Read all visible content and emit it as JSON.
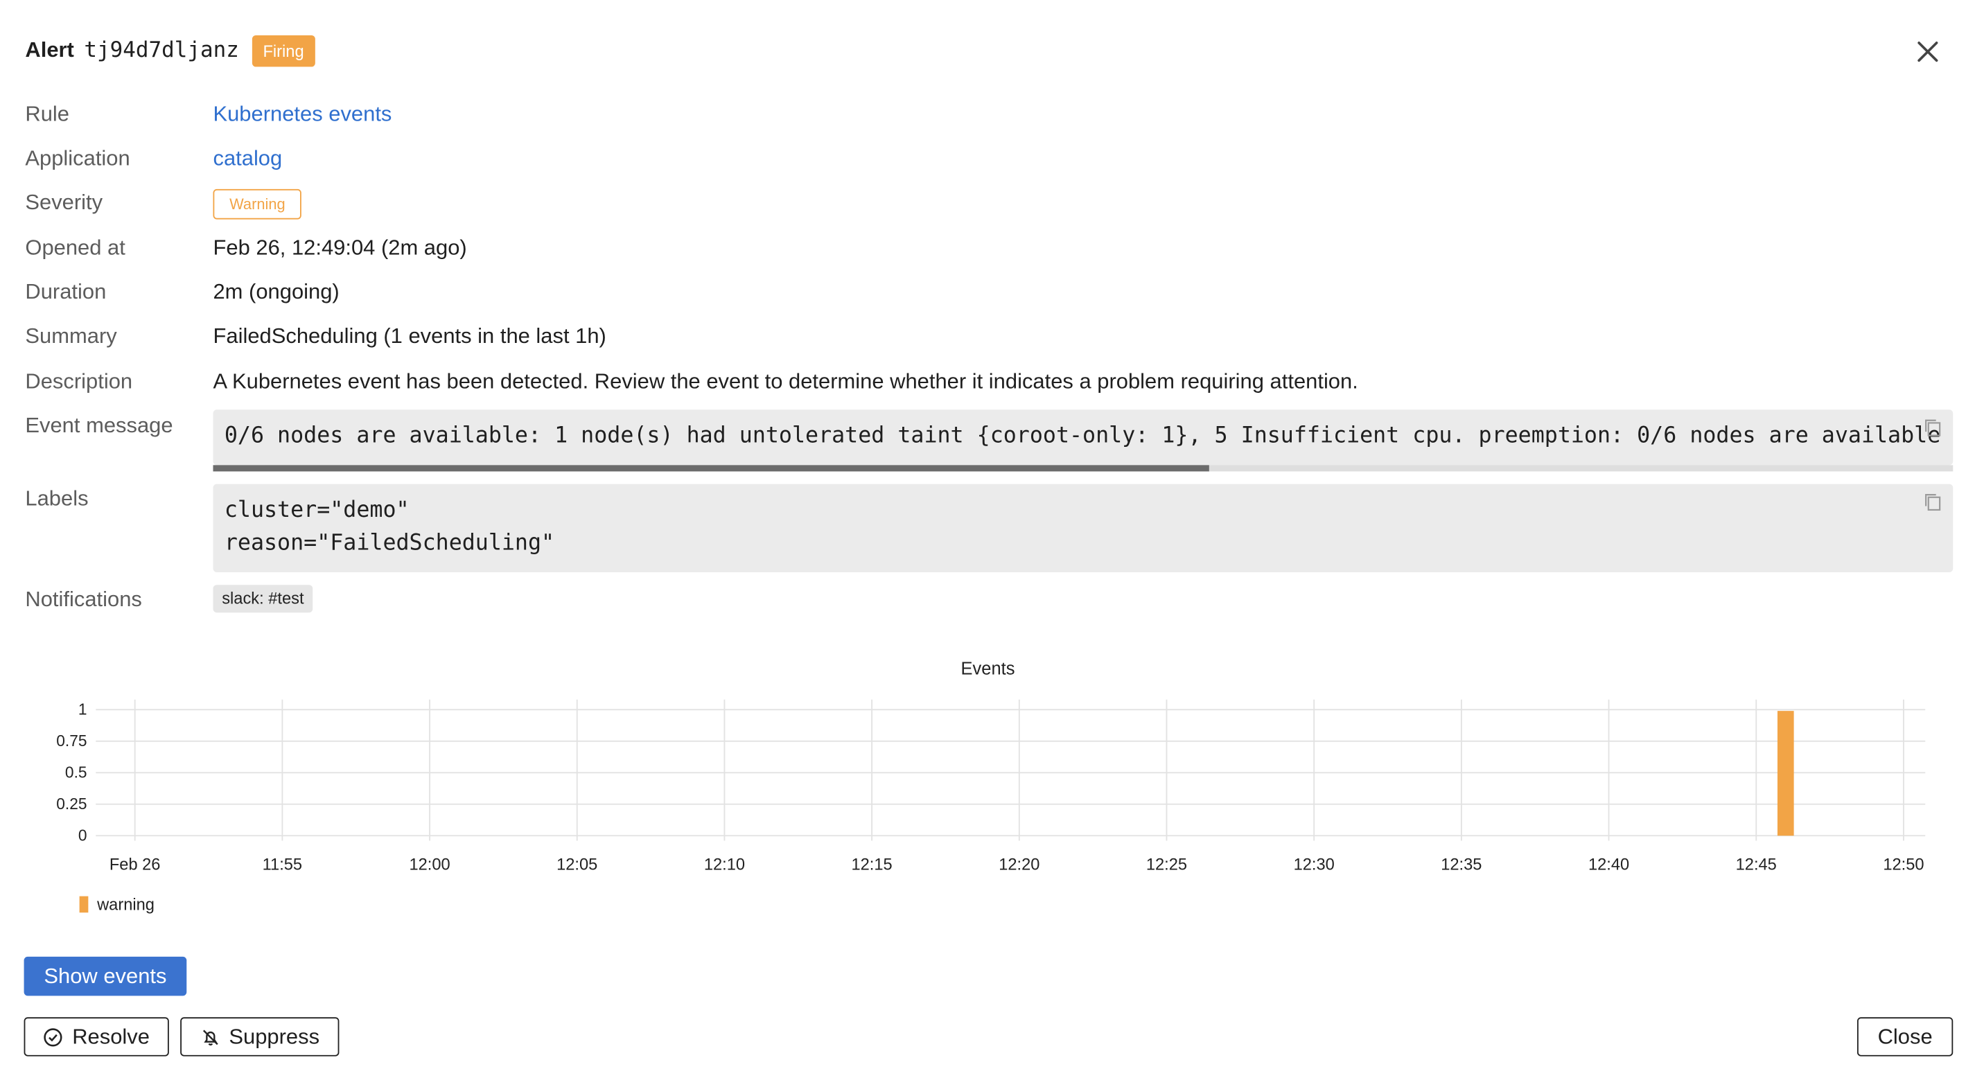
{
  "header": {
    "title_word": "Alert",
    "alert_id": "tj94d7dljanz",
    "status": "Firing"
  },
  "details": {
    "rule_label": "Rule",
    "rule_value": "Kubernetes events",
    "application_label": "Application",
    "application_value": "catalog",
    "severity_label": "Severity",
    "severity_value": "Warning",
    "opened_label": "Opened at",
    "opened_value": "Feb 26, 12:49:04 (2m ago)",
    "duration_label": "Duration",
    "duration_value": "2m (ongoing)",
    "summary_label": "Summary",
    "summary_value": "FailedScheduling (1 events in the last 1h)",
    "description_label": "Description",
    "description_value": "A Kubernetes event has been detected. Review the event to determine whether it indicates a problem requiring attention.",
    "event_message_label": "Event message",
    "event_message_value": "0/6 nodes are available: 1 node(s) had untolerated taint {coroot-only: 1}, 5 Insufficient cpu. preemption: 0/6 nodes are available",
    "labels_label": "Labels",
    "labels_line1": "cluster=\"demo\"",
    "labels_line2": "reason=\"FailedScheduling\"",
    "notifications_label": "Notifications",
    "notification_chip": "slack: #test"
  },
  "chart_data": {
    "type": "bar",
    "title": "Events",
    "x_ticks": [
      "Feb 26",
      "11:55",
      "12:00",
      "12:05",
      "12:10",
      "12:15",
      "12:20",
      "12:25",
      "12:30",
      "12:35",
      "12:40",
      "12:45",
      "12:50"
    ],
    "y_ticks": [
      "1",
      "0.75",
      "0.5",
      "0.25",
      "0"
    ],
    "ylim": [
      0,
      1
    ],
    "series": [
      {
        "name": "warning",
        "color": "#f2a446",
        "points": [
          {
            "x": "12:46",
            "y": 1
          }
        ]
      }
    ],
    "grid": true,
    "legend": "bottom-left"
  },
  "buttons": {
    "show_events": "Show events",
    "resolve": "Resolve",
    "suppress": "Suppress",
    "close": "Close"
  },
  "colors": {
    "accent": "#3b73cf",
    "firing": "#f2a446",
    "link": "#2f6fce"
  }
}
